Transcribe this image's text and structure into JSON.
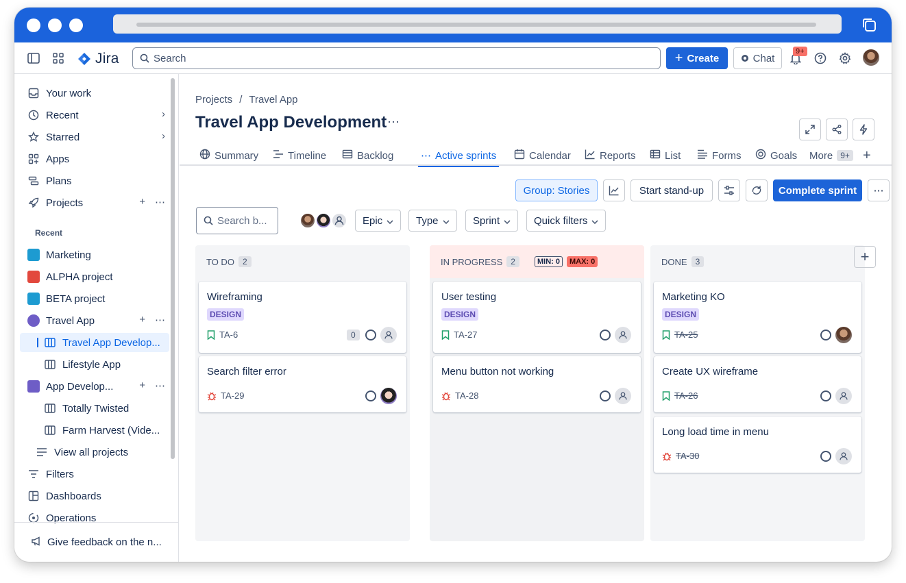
{
  "topnav": {
    "logo_text": "Jira",
    "search_placeholder": "Search",
    "create_label": "Create",
    "chat_label": "Chat",
    "notif_count": "9+"
  },
  "sidebar": {
    "your_work": "Your work",
    "recent": "Recent",
    "starred": "Starred",
    "apps": "Apps",
    "plans": "Plans",
    "projects": "Projects",
    "recent_header": "Recent",
    "projects_list": [
      {
        "label": "Marketing",
        "color": "#1d9bd1"
      },
      {
        "label": "ALPHA project",
        "color": "#e2483d"
      },
      {
        "label": "BETA project",
        "color": "#1d9bd1"
      },
      {
        "label": "Travel App",
        "color": "#6e5dc6"
      }
    ],
    "travel_boards": [
      "Travel App Develop...",
      "Lifestyle App"
    ],
    "app_develop": "App Develop...",
    "app_boards": [
      "Totally Twisted",
      "Farm Harvest (Vide..."
    ],
    "view_all": "View all projects",
    "filters": "Filters",
    "dashboards": "Dashboards",
    "operations": "Operations",
    "feedback": "Give feedback on the n..."
  },
  "main": {
    "breadcrumb": [
      "Projects",
      "/",
      "Travel App"
    ],
    "title": "Travel App Development",
    "tabs": [
      "Summary",
      "Timeline",
      "Backlog",
      "Active sprints",
      "Calendar",
      "Reports",
      "List",
      "Forms",
      "Goals",
      "More"
    ],
    "more_badge": "9+",
    "toolbar": {
      "group": "Group: Stories",
      "standup": "Start stand-up",
      "complete": "Complete sprint"
    },
    "filters": {
      "search_placeholder": "Search b...",
      "epic": "Epic",
      "type": "Type",
      "sprint": "Sprint",
      "quick": "Quick filters"
    }
  },
  "board": {
    "columns": [
      {
        "name": "TO DO",
        "count": "2",
        "cards": [
          {
            "title": "Wireframing",
            "label": "DESIGN",
            "key": "TA-6",
            "type": "story",
            "points": "0"
          },
          {
            "title": "Search filter error",
            "key": "TA-29",
            "type": "bug"
          }
        ]
      },
      {
        "name": "IN PROGRESS",
        "count": "2",
        "min": "MIN: 0",
        "max": "MAX: 0",
        "cards": [
          {
            "title": "User testing",
            "label": "DESIGN",
            "key": "TA-27",
            "type": "story"
          },
          {
            "title": "Menu button not working",
            "key": "TA-28",
            "type": "bug"
          }
        ]
      },
      {
        "name": "DONE",
        "count": "3",
        "cards": [
          {
            "title": "Marketing KO",
            "label": "DESIGN",
            "key": "TA-25",
            "type": "story"
          },
          {
            "title": "Create UX wireframe",
            "key": "TA-26",
            "type": "story"
          },
          {
            "title": "Long load time in menu",
            "key": "TA-30",
            "type": "bug"
          }
        ]
      }
    ]
  },
  "colors": {
    "brand": "#1d64d8",
    "story": "#22a06b",
    "bug": "#e2483d",
    "label_bg": "#dfd8fd",
    "label_fg": "#5e4db2"
  }
}
